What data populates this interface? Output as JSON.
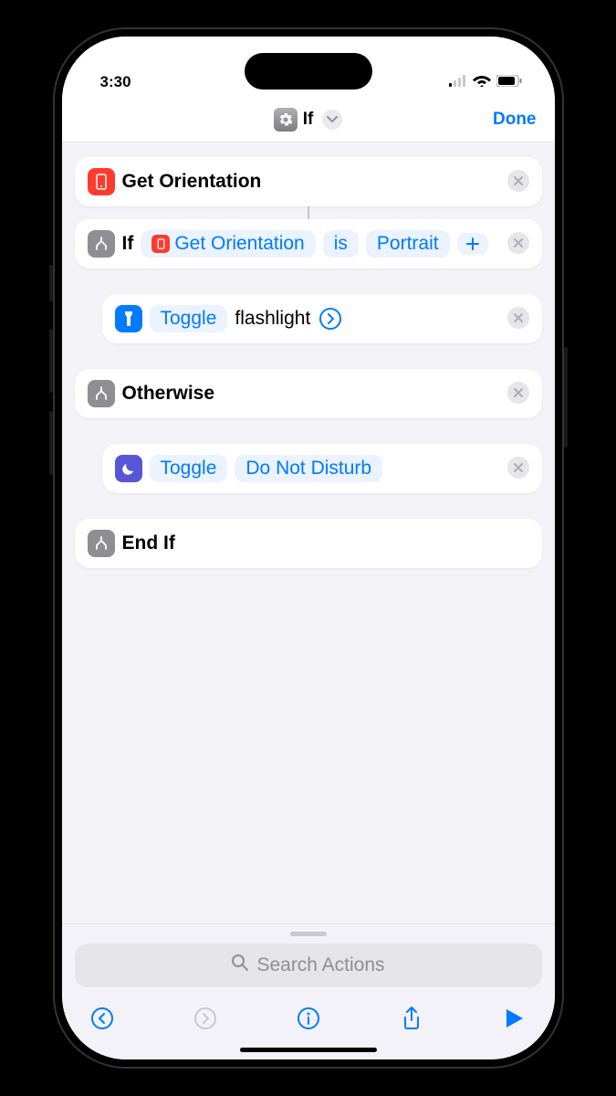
{
  "status": {
    "time": "3:30"
  },
  "nav": {
    "title": "If",
    "done": "Done"
  },
  "actions": {
    "getOrientation": {
      "label": "Get Orientation"
    },
    "ifBlock": {
      "keyword": "If",
      "varLabel": "Get Orientation",
      "condition": "is",
      "value": "Portrait"
    },
    "flashlight": {
      "op": "Toggle",
      "target": "flashlight"
    },
    "otherwise": {
      "label": "Otherwise"
    },
    "dnd": {
      "op": "Toggle",
      "target": "Do Not Disturb"
    },
    "endif": {
      "label": "End If"
    }
  },
  "search": {
    "placeholder": "Search Actions"
  }
}
